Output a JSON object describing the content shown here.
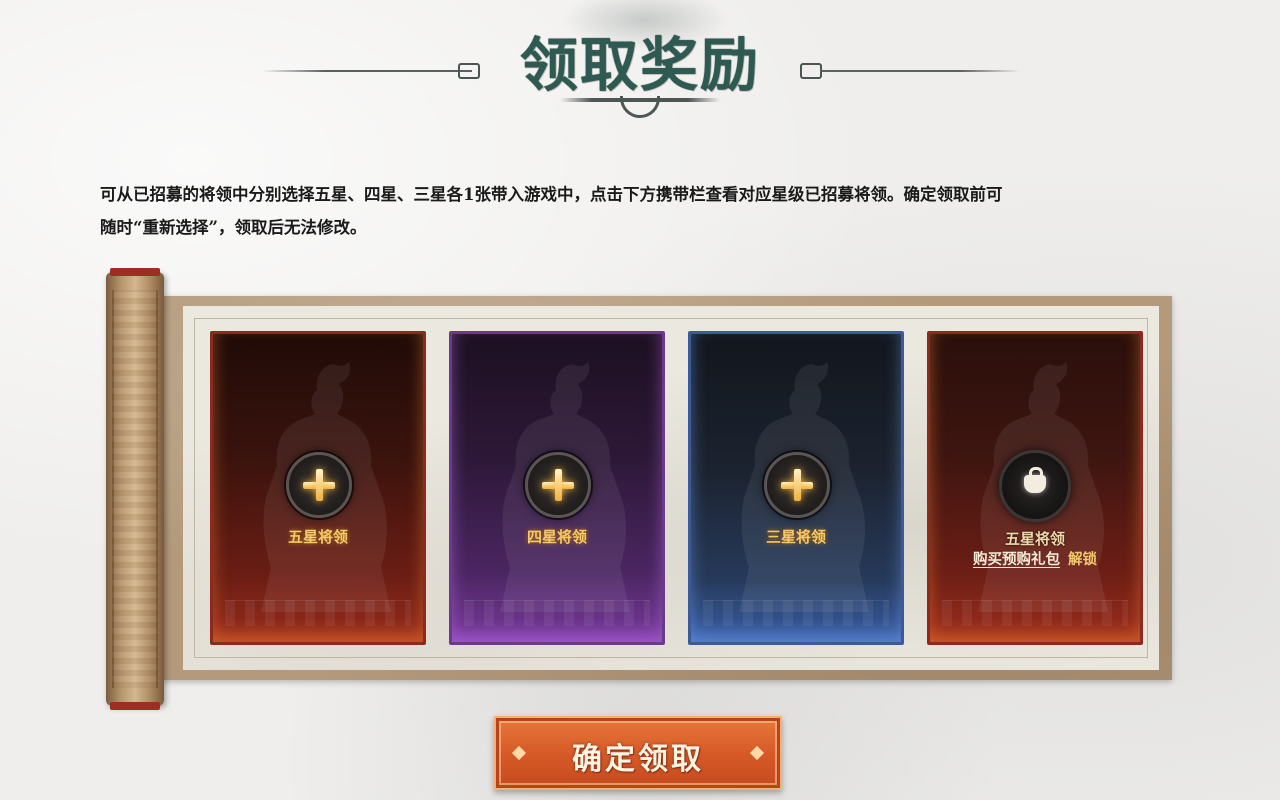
{
  "header": {
    "title": "领取奖励"
  },
  "description": {
    "line1": "可从已招募的将领中分别选择五星、四星、三星各1张带入游戏中，点击下方携带栏查看对应星级已招募将领。确定领取前可",
    "line2": "随时“重新选择”，领取后无法修改。"
  },
  "cards": [
    {
      "label": "五星将领",
      "theme": "red",
      "icon": "plus-icon",
      "color": "#8d2a1f"
    },
    {
      "label": "四星将领",
      "theme": "purple",
      "icon": "plus-icon",
      "color": "#6b3a8d"
    },
    {
      "label": "三星将领",
      "theme": "blue",
      "icon": "plus-icon",
      "color": "#3c5a9a"
    },
    {
      "label": "五星将领",
      "theme": "red-locked",
      "icon": "lock-icon",
      "color": "#8d2a1f",
      "buy_link": "购买预购礼包",
      "unlock_text": "解锁"
    }
  ],
  "actions": {
    "confirm_label": "确定领取",
    "confirm_color": "#d75a28"
  }
}
